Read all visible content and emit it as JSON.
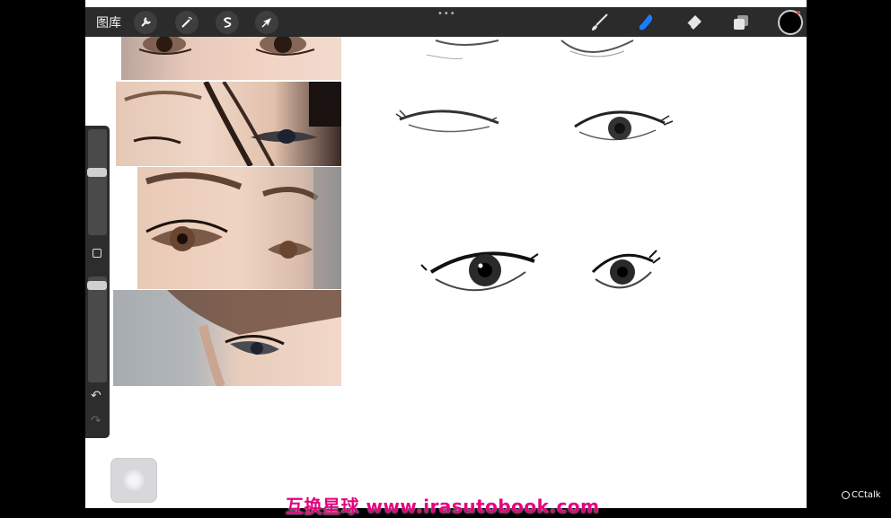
{
  "toolbar": {
    "gallery_label": "图库",
    "more_label": "•••"
  },
  "icons": {
    "actions": "wrench-icon",
    "adjustments": "magic-wand-icon",
    "selection": "selection-s-icon",
    "transform": "arrow-cursor-icon",
    "brush": "brush-icon",
    "smudge": "smudge-finger-icon",
    "eraser": "eraser-icon",
    "layers": "layers-icon",
    "color": "color-swatch"
  },
  "colors": {
    "active_tool": "#1a7cff",
    "current_color": "#000000",
    "toolbar_bg": "#2b2b2b",
    "watermark": "#e6007e"
  },
  "sidebar": {
    "brush_size_level": 0.4,
    "opacity_level": 0.05
  },
  "watermark_text": "互换星球 www.irasutobook.com",
  "brand": {
    "label": "CCtalk"
  }
}
